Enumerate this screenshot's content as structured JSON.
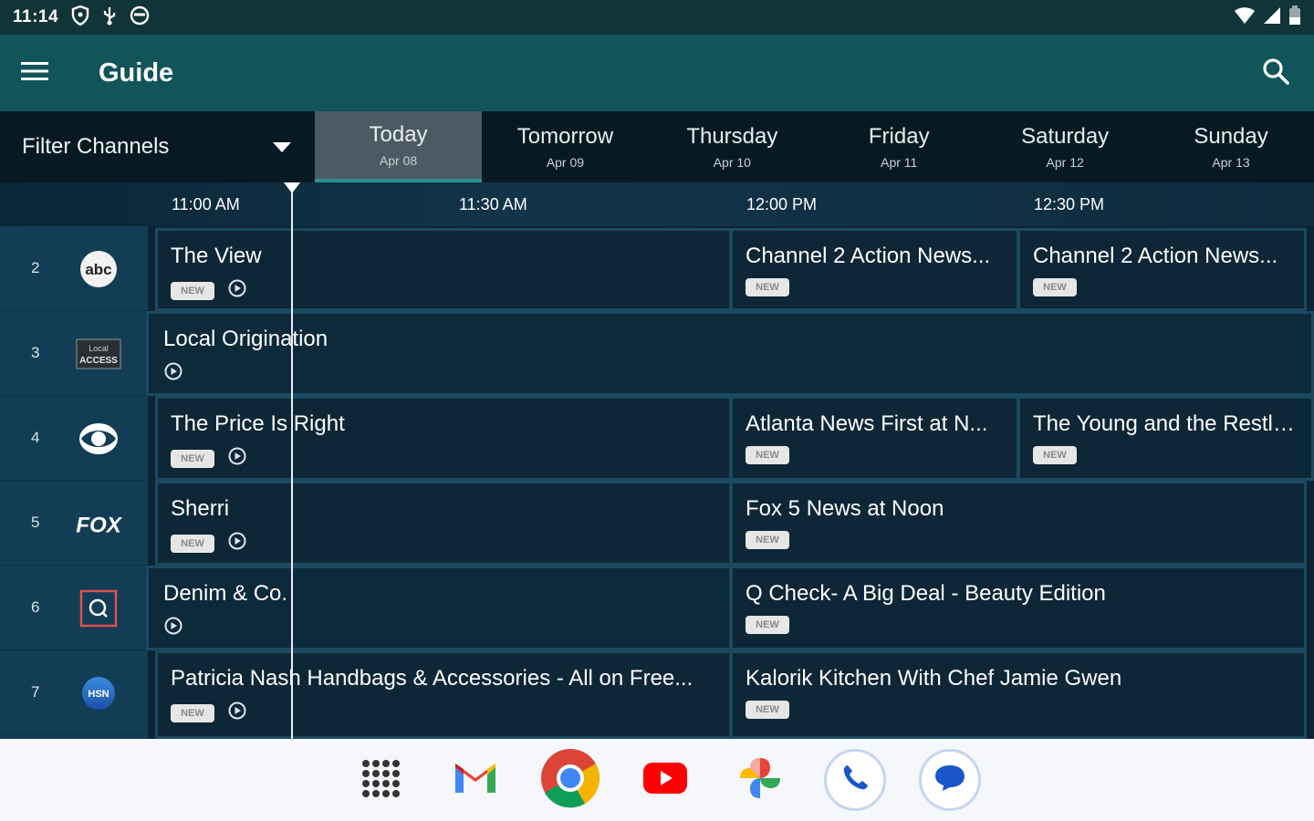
{
  "status_bar": {
    "time": "11:14",
    "left_icons": [
      "shield-icon",
      "usb-icon",
      "face-icon"
    ],
    "right_icons": [
      "wifi-icon",
      "signal-icon",
      "battery-icon"
    ]
  },
  "app_bar": {
    "title": "Guide",
    "menu_icon": "menu-icon",
    "search_icon": "search-icon"
  },
  "filter": {
    "label": "Filter Channels"
  },
  "day_tabs": [
    {
      "day": "Today",
      "date": "Apr 08",
      "active": true
    },
    {
      "day": "Tomorrow",
      "date": "Apr 09",
      "active": false
    },
    {
      "day": "Thursday",
      "date": "Apr 10",
      "active": false
    },
    {
      "day": "Friday",
      "date": "Apr 11",
      "active": false
    },
    {
      "day": "Saturday",
      "date": "Apr 12",
      "active": false
    },
    {
      "day": "Sunday",
      "date": "Apr 13",
      "active": false
    }
  ],
  "time_slots": [
    "11:00 AM",
    "11:30 AM",
    "12:00 PM",
    "12:30 PM"
  ],
  "channels": [
    {
      "number": "2",
      "logo": "abc",
      "logo_icon": "abc-logo"
    },
    {
      "number": "3",
      "logo": "Local ACCESS",
      "logo_icon": "local-access-logo"
    },
    {
      "number": "4",
      "logo": "CBS",
      "logo_icon": "cbs-eye-logo"
    },
    {
      "number": "5",
      "logo": "FOX",
      "logo_icon": "fox-logo"
    },
    {
      "number": "6",
      "logo": "QVC",
      "logo_icon": "qvc-logo"
    },
    {
      "number": "7",
      "logo": "HSN",
      "logo_icon": "hsn-logo"
    }
  ],
  "programs": {
    "r0": [
      {
        "title": "The View",
        "new": true,
        "replay": true
      },
      {
        "title": "Channel 2 Action News...",
        "new": true,
        "replay": false
      },
      {
        "title": "Channel 2 Action News...",
        "new": true,
        "replay": false
      }
    ],
    "r1": [
      {
        "title": "Local Origination",
        "new": false,
        "replay": true
      }
    ],
    "r2": [
      {
        "title": "The Price Is Right",
        "new": true,
        "replay": true
      },
      {
        "title": "Atlanta News First at N...",
        "new": true,
        "replay": false
      },
      {
        "title": "The Young and the Restless",
        "new": true,
        "replay": false
      }
    ],
    "r3": [
      {
        "title": "Sherri",
        "new": true,
        "replay": true
      },
      {
        "title": "Fox 5 News at Noon",
        "new": true,
        "replay": false
      }
    ],
    "r4": [
      {
        "title": "Denim & Co.",
        "new": false,
        "replay": true
      },
      {
        "title": "Q Check- A Big Deal - Beauty Edition",
        "new": true,
        "replay": false
      }
    ],
    "r5": [
      {
        "title": "Patricia Nash Handbags & Accessories - All on Free...",
        "new": true,
        "replay": true
      },
      {
        "title": "Kalorik Kitchen With Chef Jamie Gwen",
        "new": true,
        "replay": false
      }
    ]
  },
  "badge": {
    "new_label": "NEW"
  },
  "dock": [
    "apps-grid-icon",
    "gmail-icon",
    "chrome-icon",
    "youtube-icon",
    "photos-icon",
    "phone-icon",
    "messages-icon"
  ]
}
